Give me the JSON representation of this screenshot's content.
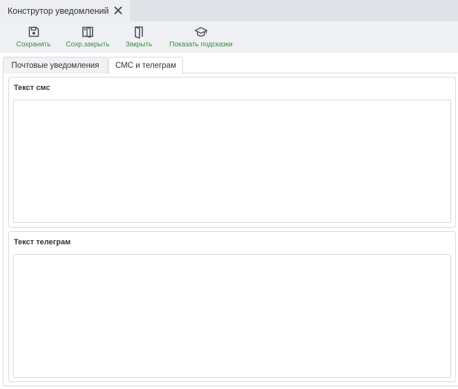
{
  "window": {
    "tab_title": "Конструтор уведомлений",
    "close_icon": "close-icon"
  },
  "toolbar": {
    "buttons": [
      {
        "label": "Сохранить",
        "icon": "save-icon"
      },
      {
        "label": "Сохр.закрыть",
        "icon": "save-close-icon"
      },
      {
        "label": "Закрыть",
        "icon": "door-icon"
      },
      {
        "label": "Показать подсказки",
        "icon": "graduation-cap-icon"
      }
    ]
  },
  "tabs": [
    {
      "label": "Почтовые уведомления",
      "active": false
    },
    {
      "label": "СМС и телеграм",
      "active": true
    }
  ],
  "content": {
    "sms_group": {
      "title": "Текст смс",
      "value": ""
    },
    "telegram_group": {
      "title": "Текст телеграм",
      "value": ""
    }
  },
  "colors": {
    "accent_green": "#3d8a3b",
    "tab_strip": "#dfe2e6",
    "toolbar_bg": "#eef0f3",
    "border": "#d5d8dc"
  }
}
